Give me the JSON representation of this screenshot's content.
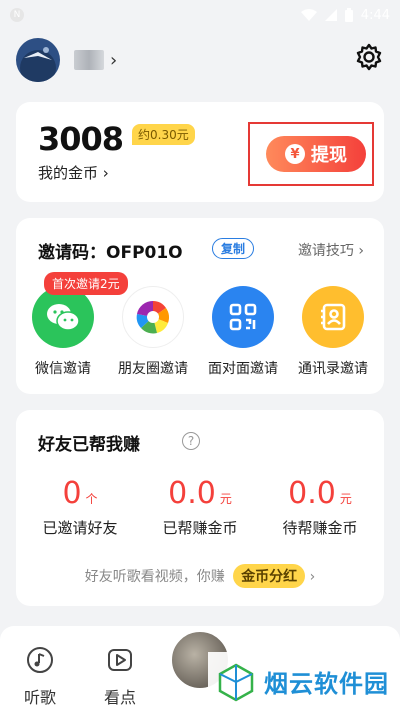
{
  "status_bar": {
    "time": "4:44",
    "notif_glyph": "N"
  },
  "header": {
    "chevron": "›"
  },
  "coins": {
    "amount": "3008",
    "approx": "约0.30元",
    "label": "我的金币 ›",
    "withdraw_label": "提现",
    "yen": "¥"
  },
  "invite": {
    "title": "邀请码：OFP01O",
    "copy_label": "复制",
    "tips_label": "邀请技巧 ›",
    "first_badge": "首次邀请2元",
    "items": [
      {
        "label": "微信邀请",
        "icon": "wechat-icon",
        "color": "#2bc45b"
      },
      {
        "label": "朋友圈邀请",
        "icon": "moments-icon",
        "color": "#ffffff"
      },
      {
        "label": "面对面邀请",
        "icon": "qrcode-icon",
        "color": "#2a84f0"
      },
      {
        "label": "通讯录邀请",
        "icon": "contacts-icon",
        "color": "#ffbe2e"
      }
    ]
  },
  "friends": {
    "title": "好友已帮我赚",
    "help": "?",
    "stats": [
      {
        "value": "0",
        "unit": "个",
        "label": "已邀请好友"
      },
      {
        "value": "0.0",
        "unit": "元",
        "label": "已帮赚金币"
      },
      {
        "value": "0.0",
        "unit": "元",
        "label": "待帮赚金币"
      }
    ],
    "note": "好友听歌看视频，你赚",
    "dividend": "金币分红",
    "note_chevron": "›"
  },
  "bottom_nav": {
    "items": [
      {
        "label": "听歌",
        "icon": "music-note-icon"
      },
      {
        "label": "看点",
        "icon": "play-icon"
      }
    ]
  },
  "watermark": {
    "text": "烟云软件园"
  },
  "colors": {
    "accent_red": "#f4403b",
    "accent_blue": "#2a7de1",
    "gold": "#ffd54a"
  }
}
